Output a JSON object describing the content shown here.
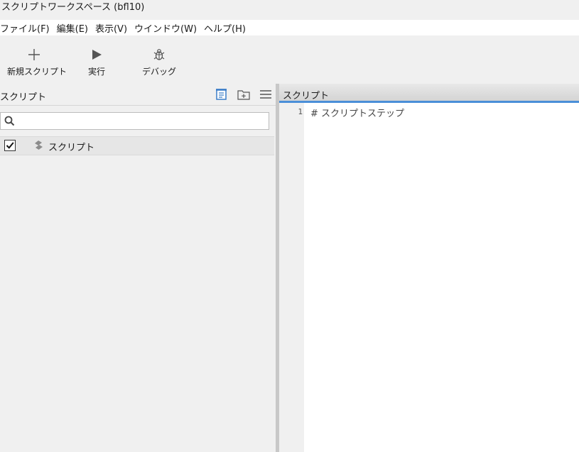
{
  "window": {
    "title": "スクリプトワークスペース (bfl10)"
  },
  "menubar": {
    "items": [
      "ファイル(F)",
      "編集(E)",
      "表示(V)",
      "ウインドウ(W)",
      "ヘルプ(H)"
    ]
  },
  "toolbar": {
    "new_script": {
      "label": "新規スクリプト",
      "icon": "plus-icon"
    },
    "run": {
      "label": "実行",
      "icon": "play-icon"
    },
    "debug": {
      "label": "デバッグ",
      "icon": "bug-icon"
    }
  },
  "left_panel": {
    "title": "スクリプト",
    "header_icons": [
      "script-list-icon",
      "add-folder-icon",
      "menu-icon"
    ],
    "search": {
      "placeholder": "",
      "value": ""
    },
    "items": [
      {
        "label": "スクリプト",
        "checked": true,
        "icon": "script-icon"
      }
    ]
  },
  "editor": {
    "tab_title": "スクリプト",
    "lines": [
      {
        "number": "1",
        "text": "# スクリプトステップ"
      }
    ]
  },
  "colors": {
    "accent": "#4a8fd8",
    "icon_blue": "#3b7dc8"
  }
}
